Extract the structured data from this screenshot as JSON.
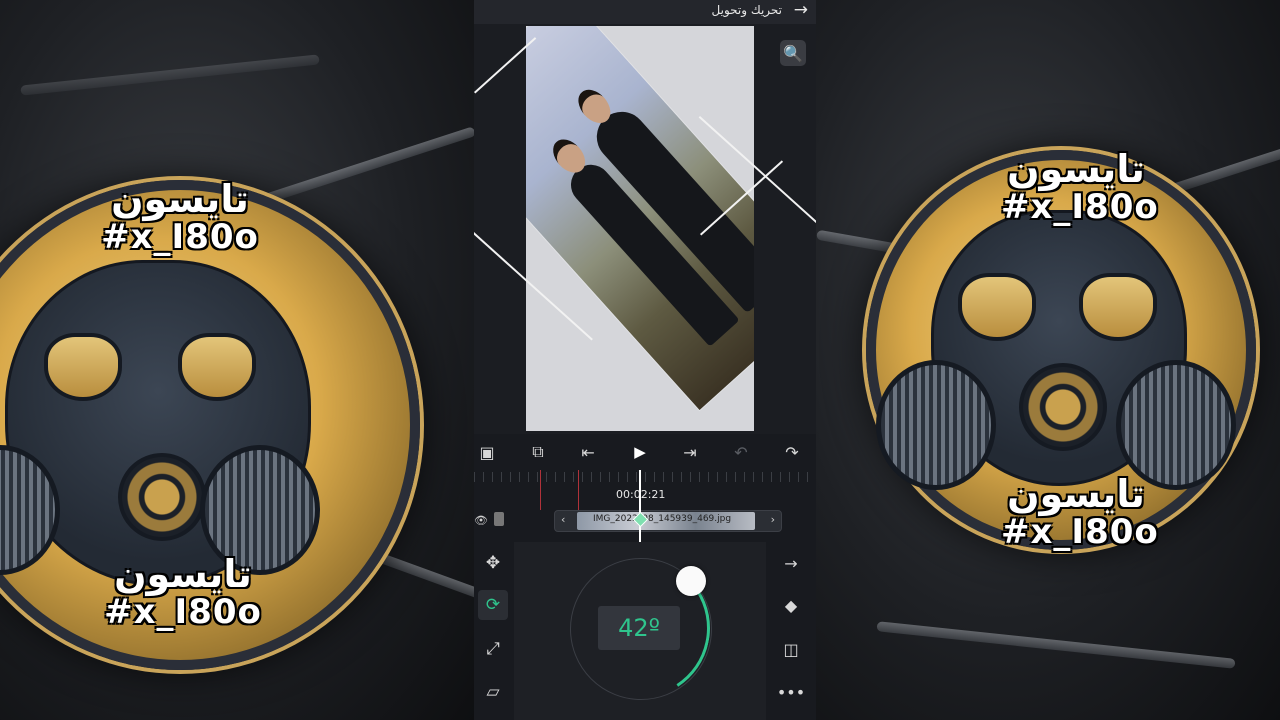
{
  "header": {
    "title": "تحريك وتحويل",
    "back_icon": "arrow-right-icon"
  },
  "preview": {
    "zoom_icon": "magnify-icon"
  },
  "controls": {
    "items": [
      "crop-icon",
      "copy-layer-icon",
      "skip-start-icon",
      "play-icon",
      "skip-end-icon",
      "undo-icon",
      "redo-icon"
    ]
  },
  "timeline": {
    "timecode": "00:02:21",
    "clip_name": "IMG_2022_08_145939_469.jpg",
    "visibility_icon": "eye-icon"
  },
  "tools_left": [
    "move-icon",
    "rotate-icon",
    "scale-icon",
    "skew-icon"
  ],
  "tools_right": [
    "arrow-right-icon",
    "keyframe-diamond-icon",
    "flip-icon",
    "more-icon"
  ],
  "rotation": {
    "angle_label": "42º",
    "angle_value": 42,
    "accent": "#2fc58d"
  },
  "background": {
    "caption_arabic": "تايسون",
    "caption_tag": "#x_I80o"
  }
}
